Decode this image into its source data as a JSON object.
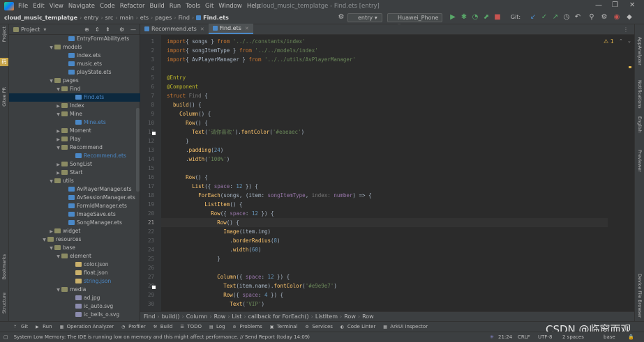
{
  "menubar": {
    "items": [
      "File",
      "Edit",
      "View",
      "Navigate",
      "Code",
      "Refactor",
      "Build",
      "Run",
      "Tools",
      "Git",
      "Window",
      "Help"
    ],
    "window_title": "cloud_music_templatge - Find.ets [entry]"
  },
  "navbar": {
    "breadcrumbs": [
      "cloud_music_templatge",
      "entry",
      "src",
      "main",
      "ets",
      "pages",
      "Find",
      "Find.ets"
    ],
    "run_config": "entry",
    "device": "Huawei_Phone",
    "git_label": "Git:"
  },
  "left_tools": [
    "Project",
    "Gitee PR",
    "Bookmarks",
    "Structure"
  ],
  "right_tools": [
    "AppAnalyzer",
    "Notifications",
    "English",
    "Previewer",
    "Device File Browser"
  ],
  "project": {
    "title": "Project",
    "tree": [
      {
        "label": "EntryFormAbility.ets",
        "depth": 8,
        "type": "ets",
        "arrow": ""
      },
      {
        "label": "models",
        "depth": 6,
        "type": "folder",
        "arrow": "v"
      },
      {
        "label": "index.ets",
        "depth": 8,
        "type": "ets",
        "arrow": ""
      },
      {
        "label": "music.ets",
        "depth": 8,
        "type": "ets",
        "arrow": ""
      },
      {
        "label": "playState.ets",
        "depth": 8,
        "type": "ets",
        "arrow": ""
      },
      {
        "label": "pages",
        "depth": 6,
        "type": "folder",
        "arrow": "v"
      },
      {
        "label": "Find",
        "depth": 7,
        "type": "folder",
        "arrow": "v"
      },
      {
        "label": "Find.ets",
        "depth": 9,
        "type": "ets",
        "arrow": "",
        "selected": true,
        "blue": true
      },
      {
        "label": "Index",
        "depth": 7,
        "type": "folder",
        "arrow": ">"
      },
      {
        "label": "Mine",
        "depth": 7,
        "type": "folder",
        "arrow": "v"
      },
      {
        "label": "Mine.ets",
        "depth": 9,
        "type": "ets",
        "arrow": "",
        "blue": true
      },
      {
        "label": "Moment",
        "depth": 7,
        "type": "folder",
        "arrow": ">"
      },
      {
        "label": "Play",
        "depth": 7,
        "type": "folder",
        "arrow": ">"
      },
      {
        "label": "Recommend",
        "depth": 7,
        "type": "folder",
        "arrow": "v"
      },
      {
        "label": "Recommend.ets",
        "depth": 9,
        "type": "ets",
        "arrow": "",
        "blue": true
      },
      {
        "label": "SongList",
        "depth": 7,
        "type": "folder",
        "arrow": ">"
      },
      {
        "label": "Start",
        "depth": 7,
        "type": "folder",
        "arrow": ">"
      },
      {
        "label": "utils",
        "depth": 6,
        "type": "folder",
        "arrow": "v"
      },
      {
        "label": "AvPlayerManager.ets",
        "depth": 8,
        "type": "ets",
        "arrow": ""
      },
      {
        "label": "AvSessionManager.ets",
        "depth": 8,
        "type": "ets",
        "arrow": ""
      },
      {
        "label": "FormIdManager.ets",
        "depth": 8,
        "type": "ets",
        "arrow": ""
      },
      {
        "label": "ImageSave.ets",
        "depth": 8,
        "type": "ets",
        "arrow": ""
      },
      {
        "label": "SongManager.ets",
        "depth": 8,
        "type": "ets",
        "arrow": ""
      },
      {
        "label": "widget",
        "depth": 6,
        "type": "folder",
        "arrow": ">"
      },
      {
        "label": "resources",
        "depth": 5,
        "type": "folder",
        "arrow": "v"
      },
      {
        "label": "base",
        "depth": 6,
        "type": "folder",
        "arrow": "v"
      },
      {
        "label": "element",
        "depth": 7,
        "type": "folder",
        "arrow": "v"
      },
      {
        "label": "color.json",
        "depth": 9,
        "type": "json",
        "arrow": ""
      },
      {
        "label": "float.json",
        "depth": 9,
        "type": "json",
        "arrow": ""
      },
      {
        "label": "string.json",
        "depth": 9,
        "type": "json",
        "arrow": "",
        "blue": true
      },
      {
        "label": "media",
        "depth": 7,
        "type": "folder",
        "arrow": "v"
      },
      {
        "label": "ad.jpg",
        "depth": 9,
        "type": "img",
        "arrow": ""
      },
      {
        "label": "ic_auto.svg",
        "depth": 9,
        "type": "img",
        "arrow": ""
      },
      {
        "label": "ic_bells_o.svg",
        "depth": 9,
        "type": "img",
        "arrow": ""
      }
    ]
  },
  "editor": {
    "tabs": [
      {
        "label": "Recommend.ets",
        "active": false
      },
      {
        "label": "Find.ets",
        "active": true
      }
    ],
    "warning_count": "1",
    "current_line": 21,
    "lines": [
      [
        [
          "kw",
          "import"
        ],
        [
          "",
          "{ songs } "
        ],
        [
          "kw",
          "from"
        ],
        [
          "str",
          " '../../constants/index'"
        ]
      ],
      [
        [
          "kw",
          "import"
        ],
        [
          "",
          "{ songItemType } "
        ],
        [
          "kw",
          "from"
        ],
        [
          "str",
          " '../../models/index'"
        ]
      ],
      [
        [
          "kw",
          "import"
        ],
        [
          "",
          "{ AvPlayerManager } "
        ],
        [
          "kw",
          "from"
        ],
        [
          "str",
          " '../../utils/AvPlayerManager'"
        ]
      ],
      [],
      [
        [
          "ann",
          "@Entry"
        ]
      ],
      [
        [
          "ann",
          "@Component"
        ]
      ],
      [
        [
          "kw",
          "struct "
        ],
        [
          "hint",
          "Find"
        ],
        [
          "",
          " {"
        ]
      ],
      [
        [
          "",
          "  "
        ],
        [
          "fn",
          "build"
        ],
        [
          "",
          "() {"
        ]
      ],
      [
        [
          "",
          "    "
        ],
        [
          "fn",
          "Column"
        ],
        [
          "",
          "() {"
        ]
      ],
      [
        [
          "",
          "      "
        ],
        [
          "fn",
          "Row"
        ],
        [
          "",
          "() {"
        ]
      ],
      [
        [
          "",
          "        "
        ],
        [
          "fn",
          "Text"
        ],
        [
          "",
          "("
        ],
        [
          "str",
          "'请你喜欢'"
        ],
        [
          "",
          ")."
        ],
        [
          "fn",
          "fontColor"
        ],
        [
          "",
          "("
        ],
        [
          "str",
          "'#eaeaec'"
        ],
        [
          "",
          ")"
        ]
      ],
      [
        [
          "",
          "      }"
        ]
      ],
      [
        [
          "",
          "      ."
        ],
        [
          "fn",
          "padding"
        ],
        [
          "",
          "("
        ],
        [
          "num",
          "24"
        ],
        [
          "",
          ")"
        ]
      ],
      [
        [
          "",
          "      ."
        ],
        [
          "fn",
          "width"
        ],
        [
          "",
          "("
        ],
        [
          "str",
          "'100%'"
        ],
        [
          "",
          ")"
        ]
      ],
      [],
      [
        [
          "",
          "      "
        ],
        [
          "fn",
          "Row"
        ],
        [
          "",
          "() {"
        ]
      ],
      [
        [
          "",
          "        "
        ],
        [
          "fn",
          "List"
        ],
        [
          "",
          "({ "
        ],
        [
          "lbl",
          "space"
        ],
        [
          "",
          ": "
        ],
        [
          "num",
          "12"
        ],
        [
          "",
          " }) {"
        ]
      ],
      [
        [
          "",
          "          "
        ],
        [
          "fn",
          "ForEach"
        ],
        [
          "",
          "(songs, (item: "
        ],
        [
          "lbl",
          "songItemType"
        ],
        [
          "",
          ", "
        ],
        [
          "hint",
          "index: "
        ],
        [
          "lbl",
          "number"
        ],
        [
          "",
          ") => {"
        ]
      ],
      [
        [
          "",
          "            "
        ],
        [
          "fn",
          "ListItem"
        ],
        [
          "",
          "() {"
        ]
      ],
      [
        [
          "",
          "              "
        ],
        [
          "fn",
          "Row"
        ],
        [
          "",
          "({ "
        ],
        [
          "lbl",
          "space"
        ],
        [
          "",
          ": "
        ],
        [
          "num",
          "12"
        ],
        [
          "",
          " }) {"
        ]
      ],
      [
        [
          "",
          "                "
        ],
        [
          "fn",
          "Row"
        ],
        [
          "",
          "() {"
        ]
      ],
      [
        [
          "",
          "                  "
        ],
        [
          "fn",
          "Image"
        ],
        [
          "",
          "(item.img)"
        ]
      ],
      [
        [
          "",
          "                    ."
        ],
        [
          "fn",
          "borderRadius"
        ],
        [
          "",
          "("
        ],
        [
          "num",
          "8"
        ],
        [
          "",
          ")"
        ]
      ],
      [
        [
          "",
          "                    ."
        ],
        [
          "fn",
          "width"
        ],
        [
          "",
          "("
        ],
        [
          "num",
          "60"
        ],
        [
          "",
          ")"
        ]
      ],
      [
        [
          "",
          "                }"
        ]
      ],
      [],
      [
        [
          "",
          "                "
        ],
        [
          "fn",
          "Column"
        ],
        [
          "",
          "({ "
        ],
        [
          "lbl",
          "space"
        ],
        [
          "",
          ": "
        ],
        [
          "num",
          "12"
        ],
        [
          "",
          " }) {"
        ]
      ],
      [
        [
          "",
          "                  "
        ],
        [
          "fn",
          "Text"
        ],
        [
          "",
          "(item.name)."
        ],
        [
          "fn",
          "fontColor"
        ],
        [
          "",
          "("
        ],
        [
          "str",
          "'#e9e9e7'"
        ],
        [
          "",
          ")"
        ]
      ],
      [
        [
          "",
          "                  "
        ],
        [
          "fn",
          "Row"
        ],
        [
          "",
          "({ "
        ],
        [
          "lbl",
          "space"
        ],
        [
          "",
          ": "
        ],
        [
          "num",
          "4"
        ],
        [
          "",
          " }) {"
        ]
      ],
      [
        [
          "",
          "                    "
        ],
        [
          "fn",
          "Text"
        ],
        [
          "",
          "("
        ],
        [
          "str",
          "'VIP'"
        ],
        [
          "",
          ")"
        ]
      ]
    ],
    "gutter_marks": [
      11,
      28
    ],
    "breadcrumb": [
      "Find",
      "build()",
      "Column",
      "Row",
      "List",
      "callback for ForEach()",
      "ListItem",
      "Row",
      "Row"
    ]
  },
  "tool_windows": [
    "Git",
    "Run",
    "Operation Analyzer",
    "Profiler",
    "Build",
    "TODO",
    "Log",
    "Problems",
    "Terminal",
    "Services",
    "Code Linter",
    "ArkUI Inspector"
  ],
  "status": {
    "message": "System Low Memory: The IDE is running low on memory and this might affect performance. // Send Report (today 14:09)",
    "position": "21:24",
    "line_sep": "CRLF",
    "encoding": "UTF-8",
    "indent": "2 spaces",
    "branch": "base",
    "watermark": "CSDN @临窗而观"
  }
}
